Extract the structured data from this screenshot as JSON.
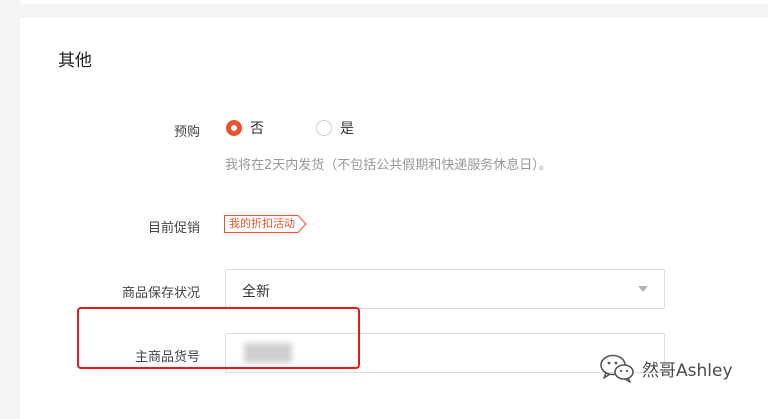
{
  "section": {
    "title": "其他"
  },
  "preorder": {
    "label": "预购",
    "options": [
      {
        "label": "否",
        "checked": true
      },
      {
        "label": "是",
        "checked": false
      }
    ],
    "hint": "我将在2天内发货（不包括公共假期和快递服务休息日）。"
  },
  "promotion": {
    "label": "目前促销",
    "tag": "我的折扣活动"
  },
  "condition": {
    "label": "商品保存状况",
    "selected": "全新"
  },
  "sku": {
    "label": "主商品货号",
    "value": ""
  },
  "watermark": {
    "text": "然哥Ashley",
    "icon": "wechat-icon"
  },
  "colors": {
    "accent": "#e8542c",
    "highlight": "#e51a1a"
  }
}
